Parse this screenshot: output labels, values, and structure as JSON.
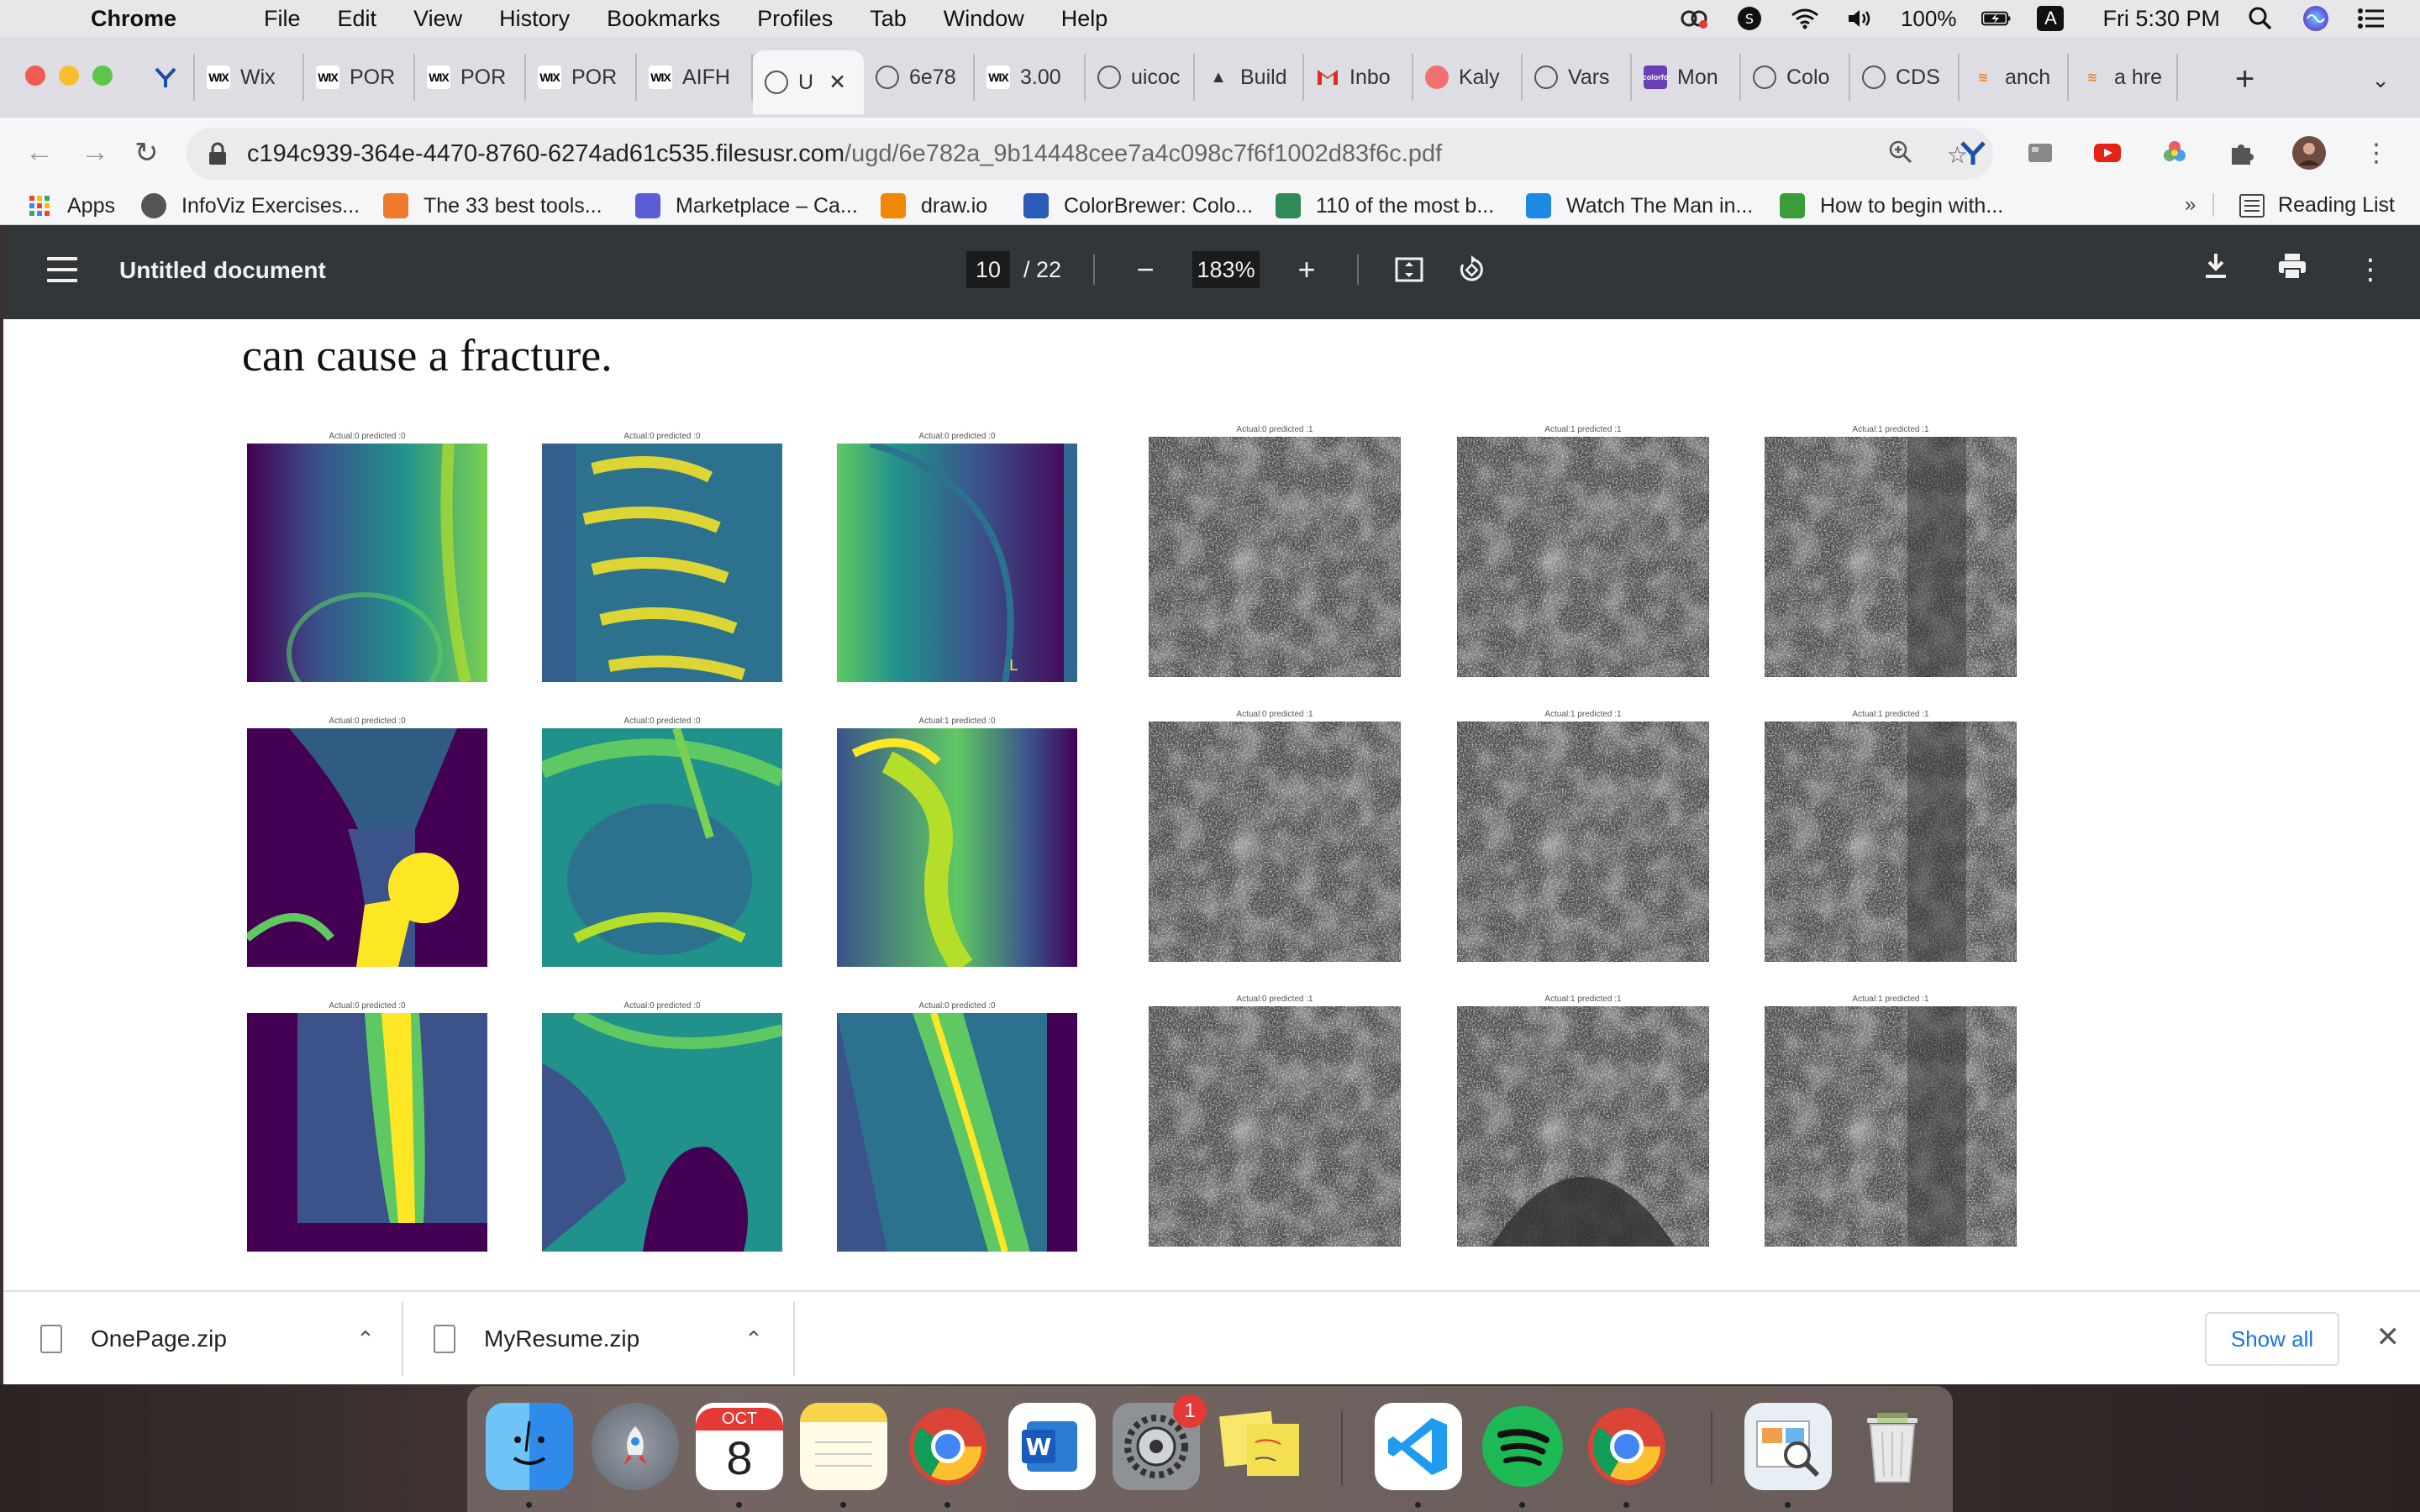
{
  "menubar": {
    "app_name": "Chrome",
    "menus": [
      "File",
      "Edit",
      "View",
      "History",
      "Bookmarks",
      "Profiles",
      "Tab",
      "Window",
      "Help"
    ],
    "battery": "100%",
    "input_source": "A",
    "clock": "Fri 5:30 PM"
  },
  "tabs": [
    {
      "label": "",
      "favicon": "y-icon"
    },
    {
      "label": "Wix",
      "favicon": "wix"
    },
    {
      "label": "POR",
      "favicon": "wix"
    },
    {
      "label": "POR",
      "favicon": "wix"
    },
    {
      "label": "POR",
      "favicon": "wix"
    },
    {
      "label": "AIFH",
      "favicon": "wix"
    },
    {
      "label": "U",
      "favicon": "globe",
      "active": true
    },
    {
      "label": "6e78",
      "favicon": "globe"
    },
    {
      "label": "3.00",
      "favicon": "wix"
    },
    {
      "label": "uicoc",
      "favicon": "globe"
    },
    {
      "label": "Build",
      "favicon": "triangle"
    },
    {
      "label": "Inbo",
      "favicon": "gmail"
    },
    {
      "label": "Kaly",
      "favicon": "red-circle"
    },
    {
      "label": "Vars",
      "favicon": "globe"
    },
    {
      "label": "Mon",
      "favicon": "colorfo"
    },
    {
      "label": "Colo",
      "favicon": "globe"
    },
    {
      "label": "CDS",
      "favicon": "globe"
    },
    {
      "label": "anch",
      "favicon": "stack"
    },
    {
      "label": "a hre",
      "favicon": "stack"
    }
  ],
  "address": {
    "host": "c194c939-364e-4470-8760-6274ad61c535.filesusr.com",
    "path": "/ugd/6e782a_9b14448cee7a4c098c7f6f1002d83f6c.pdf"
  },
  "bookmarks": [
    {
      "label": "Apps",
      "icon": "apps-grid-icon",
      "color": "#e8453c"
    },
    {
      "label": "InfoViz Exercises...",
      "icon": "globe-icon",
      "color": "#555555"
    },
    {
      "label": "The 33 best tools...",
      "icon": "cb-icon",
      "color": "#f07b2a"
    },
    {
      "label": "Marketplace – Ca...",
      "icon": "c-icon",
      "color": "#5b5bd6"
    },
    {
      "label": "draw.io",
      "icon": "drawio-icon",
      "color": "#f08705"
    },
    {
      "label": "ColorBrewer: Colo...",
      "icon": "colorbrewer-icon",
      "color": "#2a5bb8"
    },
    {
      "label": "110 of the most b...",
      "icon": "image-icon",
      "color": "#2e8b57"
    },
    {
      "label": "Watch The Man in...",
      "icon": "play-icon",
      "color": "#1e88e5"
    },
    {
      "label": "How to begin with...",
      "icon": "link-icon",
      "color": "#3a9d3a"
    }
  ],
  "reading_list": "Reading List",
  "pdf": {
    "title": "Untitled document",
    "page": "10",
    "page_total": "/ 22",
    "zoom": "183%",
    "body_text": "can cause a fracture.",
    "xray_grid": [
      {
        "caption": "Actual:0 predicted :0"
      },
      {
        "caption": "Actual:0 predicted :0"
      },
      {
        "caption": "Actual:0 predicted :0"
      },
      {
        "caption": "Actual:0 predicted :0"
      },
      {
        "caption": "Actual:0 predicted :0"
      },
      {
        "caption": "Actual:1 predicted :0"
      },
      {
        "caption": "Actual:0 predicted :0"
      },
      {
        "caption": "Actual:0 predicted :0"
      },
      {
        "caption": "Actual:0 predicted :0"
      }
    ],
    "saliency_grid": [
      {
        "caption": "Actual:0 predicted :1"
      },
      {
        "caption": "Actual:1 predicted :1"
      },
      {
        "caption": "Actual:1 predicted :1"
      },
      {
        "caption": "Actual:0 predicted :1"
      },
      {
        "caption": "Actual:1 predicted :1"
      },
      {
        "caption": "Actual:1 predicted :1"
      },
      {
        "caption": "Actual:0 predicted :1"
      },
      {
        "caption": "Actual:1 predicted :1"
      },
      {
        "caption": "Actual:1 predicted :1"
      }
    ],
    "marker_letter": "L"
  },
  "downloads": {
    "items": [
      "OnePage.zip",
      "MyResume.zip"
    ],
    "show_all": "Show all"
  },
  "dock": {
    "calendar_month": "OCT",
    "calendar_day": "8",
    "badge_count": "1",
    "apps": [
      "Finder",
      "Launchpad",
      "Calendar",
      "Notes",
      "Chrome",
      "Word",
      "System Preferences",
      "Stickies",
      "VS Code",
      "Spotify",
      "Chrome",
      "Preview",
      "Trash"
    ]
  },
  "colors": {
    "pdf_toolbar": "#323639",
    "viridis_dark": "#440154",
    "viridis_mid": "#21918c",
    "viridis_light": "#fde725",
    "link_blue": "#1a73e8"
  }
}
